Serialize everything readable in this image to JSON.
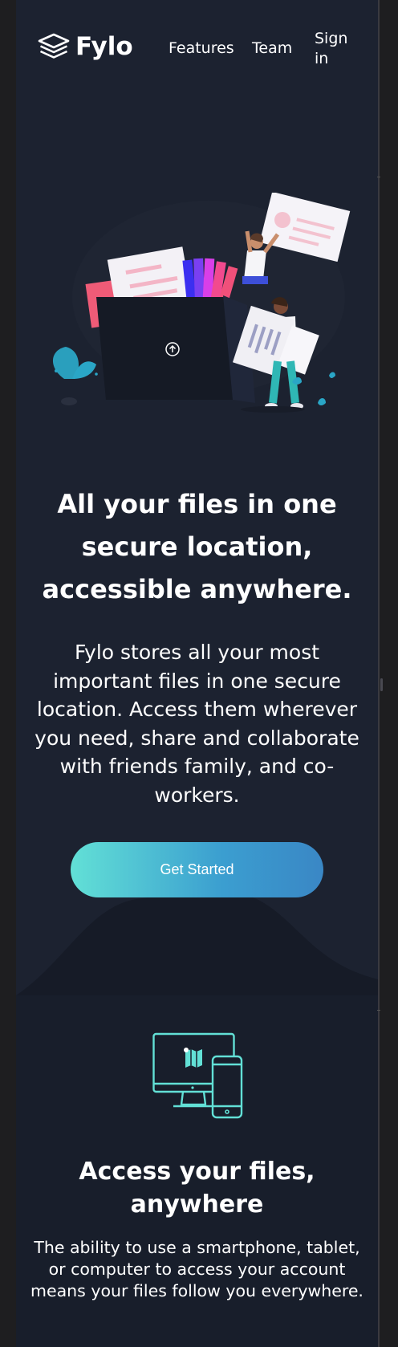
{
  "brand": {
    "name": "Fylo"
  },
  "nav": {
    "items": [
      {
        "label": "Features"
      },
      {
        "label": "Team"
      },
      {
        "label": "Sign in"
      }
    ]
  },
  "hero": {
    "title": "All your files in one secure location, accessible anywhere.",
    "description": "Fylo stores all your most important files in one secure location. Access them wherever you need, share and collaborate with friends family, and co-workers.",
    "cta_label": "Get Started",
    "illustration": "files-upload-illustration"
  },
  "features": [
    {
      "icon": "devices-icon",
      "title": "Access your files, anywhere",
      "description": "The ability to use a smartphone, tablet, or computer to access your account means your files follow you everywhere."
    }
  ],
  "colors": {
    "background": "#1c2230",
    "feature_background": "#181e2b",
    "accent_cyan": "#62e0d6",
    "accent_blue": "#3a87c5",
    "text": "#ffffff"
  }
}
